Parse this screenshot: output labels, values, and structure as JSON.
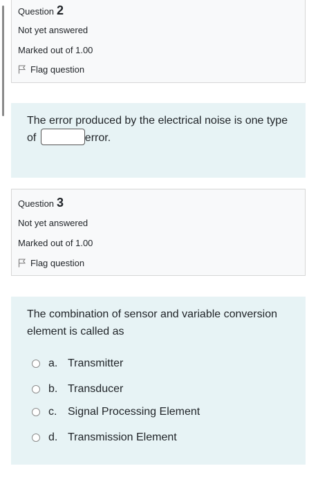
{
  "question2": {
    "label": "Question",
    "number": "2",
    "state": "Not yet answered",
    "grade": "Marked out of 1.00",
    "flag": "Flag question",
    "text_before": "The error produced by the electrical noise is one type of",
    "blank_value": "",
    "text_after": "error."
  },
  "question3": {
    "label": "Question",
    "number": "3",
    "state": "Not yet answered",
    "grade": "Marked out of 1.00",
    "flag": "Flag question",
    "text": "The combination of sensor and variable conversion element is called as",
    "options": [
      {
        "letter": "a.",
        "label": "Transmitter"
      },
      {
        "letter": "b.",
        "label": "Transducer"
      },
      {
        "letter": "c.",
        "label": "Signal Processing Element"
      },
      {
        "letter": "d.",
        "label": "Transmission Element"
      }
    ]
  },
  "icons": {
    "flag": "flag-icon",
    "radio": "radio-button"
  }
}
